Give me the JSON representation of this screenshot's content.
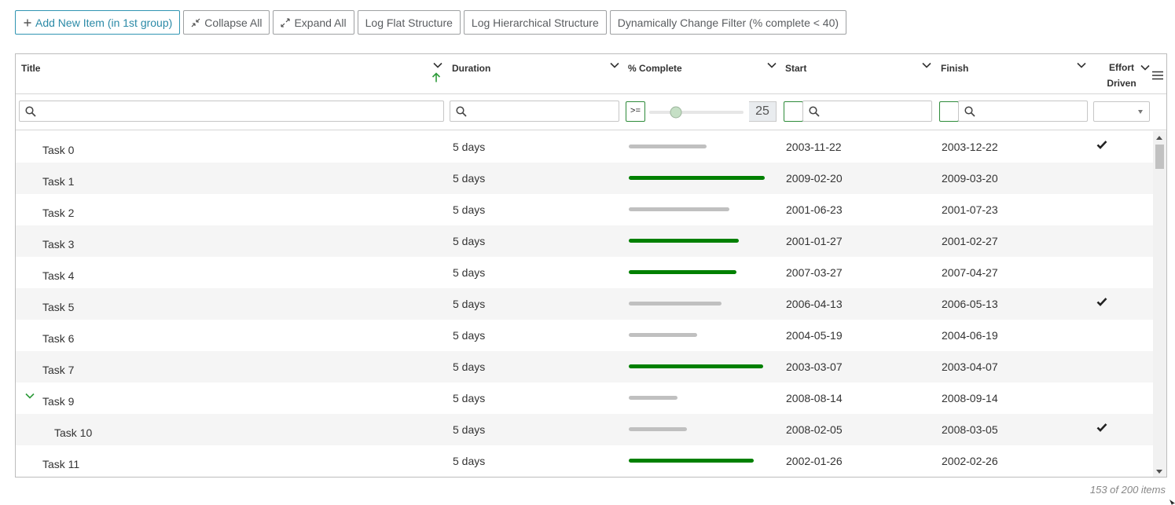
{
  "toolbar": {
    "add_label": "Add New Item (in 1st group)",
    "collapse_label": "Collapse All",
    "expand_label": "Expand All",
    "log_flat_label": "Log Flat Structure",
    "log_hier_label": "Log Hierarchical Structure",
    "dyn_filter_label": "Dynamically Change Filter (% complete < 40)"
  },
  "columns": {
    "title": "Title",
    "duration": "Duration",
    "percent": "% Complete",
    "start": "Start",
    "finish": "Finish",
    "effort_line1": "Effort",
    "effort_line2": "Driven"
  },
  "filters": {
    "percent_operator": ">=",
    "percent_value": "25",
    "percent_level": 0.25,
    "title_search": "",
    "duration_search": "",
    "start_search": "",
    "finish_search": "",
    "effort_select": ""
  },
  "rows": [
    {
      "title": "Task 0",
      "level": 0,
      "duration": "5 days",
      "percent": 57,
      "start": "2003-11-22",
      "finish": "2003-12-22",
      "effort": true
    },
    {
      "title": "Task 1",
      "level": 0,
      "duration": "5 days",
      "percent": 100,
      "start": "2009-02-20",
      "finish": "2009-03-20",
      "effort": false
    },
    {
      "title": "Task 2",
      "level": 0,
      "duration": "5 days",
      "percent": 74,
      "start": "2001-06-23",
      "finish": "2001-07-23",
      "effort": false
    },
    {
      "title": "Task 3",
      "level": 0,
      "duration": "5 days",
      "percent": 81,
      "start": "2001-01-27",
      "finish": "2001-02-27",
      "effort": false
    },
    {
      "title": "Task 4",
      "level": 0,
      "duration": "5 days",
      "percent": 79,
      "start": "2007-03-27",
      "finish": "2007-04-27",
      "effort": false
    },
    {
      "title": "Task 5",
      "level": 0,
      "duration": "5 days",
      "percent": 68,
      "start": "2006-04-13",
      "finish": "2006-05-13",
      "effort": true
    },
    {
      "title": "Task 6",
      "level": 0,
      "duration": "5 days",
      "percent": 50,
      "start": "2004-05-19",
      "finish": "2004-06-19",
      "effort": false
    },
    {
      "title": "Task 7",
      "level": 0,
      "duration": "5 days",
      "percent": 99,
      "start": "2003-03-07",
      "finish": "2003-04-07",
      "effort": false
    },
    {
      "title": "Task 9",
      "level": 0,
      "duration": "5 days",
      "percent": 36,
      "start": "2008-08-14",
      "finish": "2008-09-14",
      "effort": false,
      "expanded": true
    },
    {
      "title": "Task 10",
      "level": 1,
      "duration": "5 days",
      "percent": 43,
      "start": "2008-02-05",
      "finish": "2008-03-05",
      "effort": true
    },
    {
      "title": "Task 11",
      "level": 0,
      "duration": "5 days",
      "percent": 92,
      "start": "2002-01-26",
      "finish": "2002-02-26",
      "effort": false
    }
  ],
  "footer": {
    "count_text": "153 of 200 items"
  },
  "colors": {
    "progress_high": "#008000",
    "progress_low": "#c0c0c0",
    "accent": "#2b8aa7"
  }
}
